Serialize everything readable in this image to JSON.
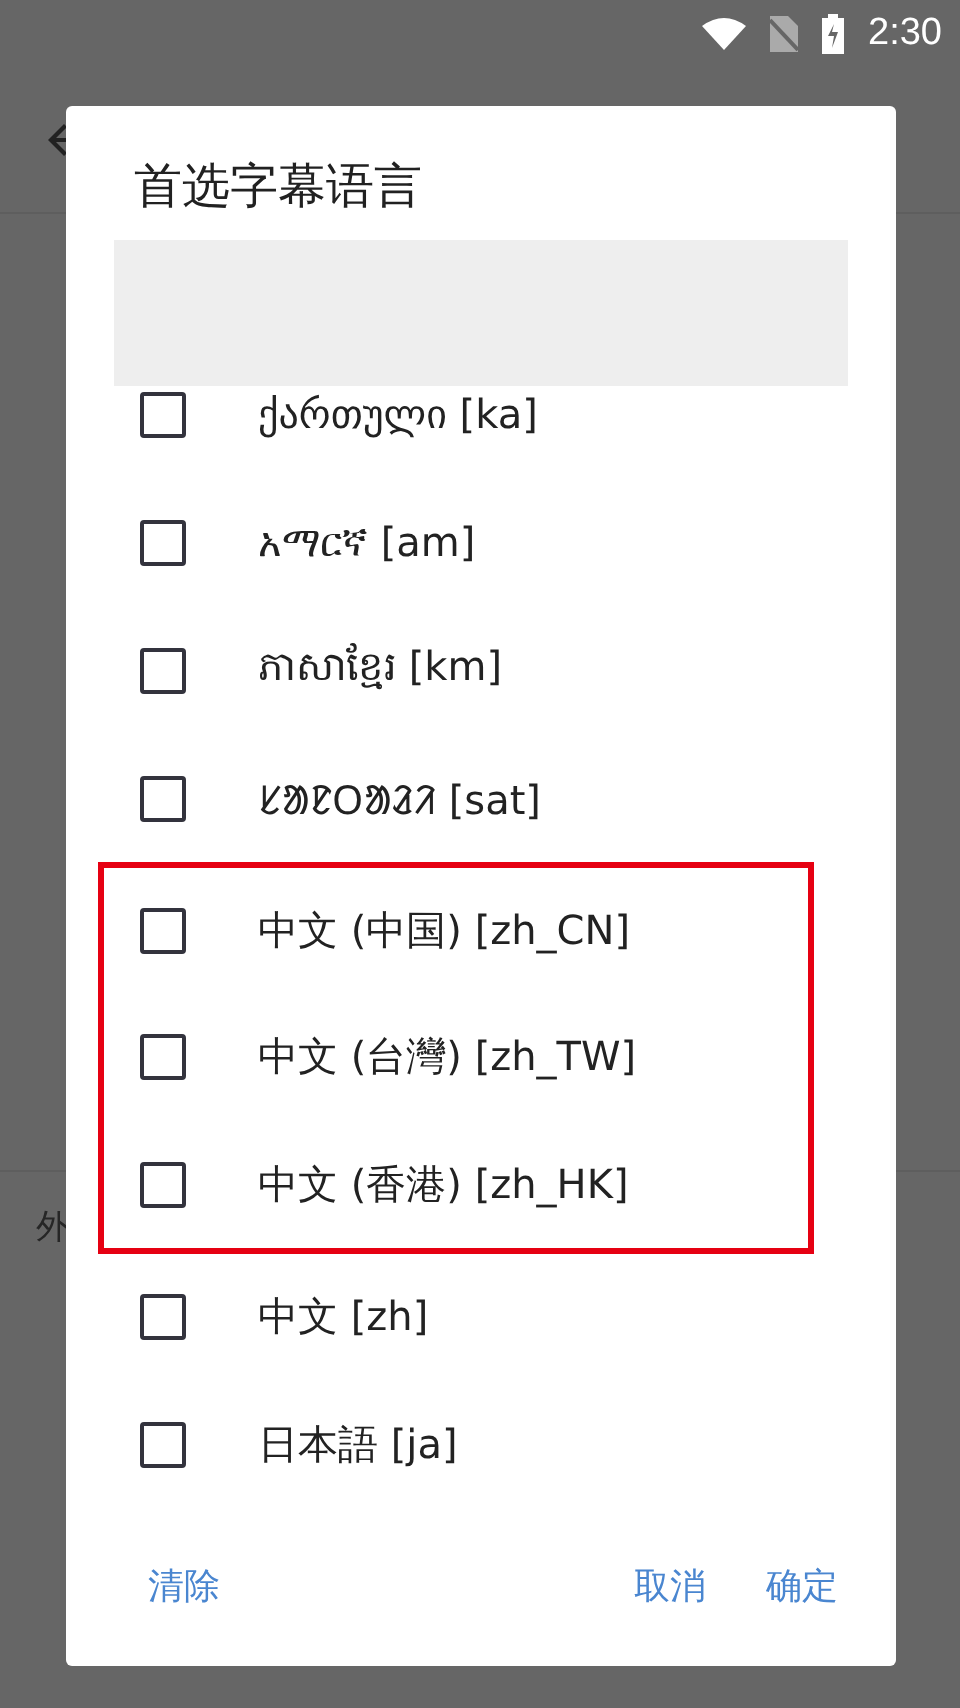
{
  "status_bar": {
    "time": "2:30"
  },
  "settings": [
    {
      "kind": "section",
      "title": "外"
    }
  ],
  "dialog": {
    "title": "首选字幕语言",
    "options": [
      {
        "label": "ქართული [ka]",
        "checked": false,
        "highlighted": false
      },
      {
        "label": "አማርኛ [am]",
        "checked": false,
        "highlighted": false
      },
      {
        "label": "ភាសាខ្មែរ [km]",
        "checked": false,
        "highlighted": false
      },
      {
        "label": "ᱥᱟᱱᱛᱟᱲᱤ [sat]",
        "checked": false,
        "highlighted": false
      },
      {
        "label": "中文 (中国) [zh_CN]",
        "checked": false,
        "highlighted": true
      },
      {
        "label": "中文 (台灣) [zh_TW]",
        "checked": false,
        "highlighted": true
      },
      {
        "label": "中文 (香港) [zh_HK]",
        "checked": false,
        "highlighted": true
      },
      {
        "label": "中文 [zh]",
        "checked": false,
        "highlighted": false
      },
      {
        "label": "日本語 [ja]",
        "checked": false,
        "highlighted": false
      }
    ],
    "buttons": {
      "left": "清除",
      "right": [
        "取消",
        "确定"
      ]
    }
  }
}
